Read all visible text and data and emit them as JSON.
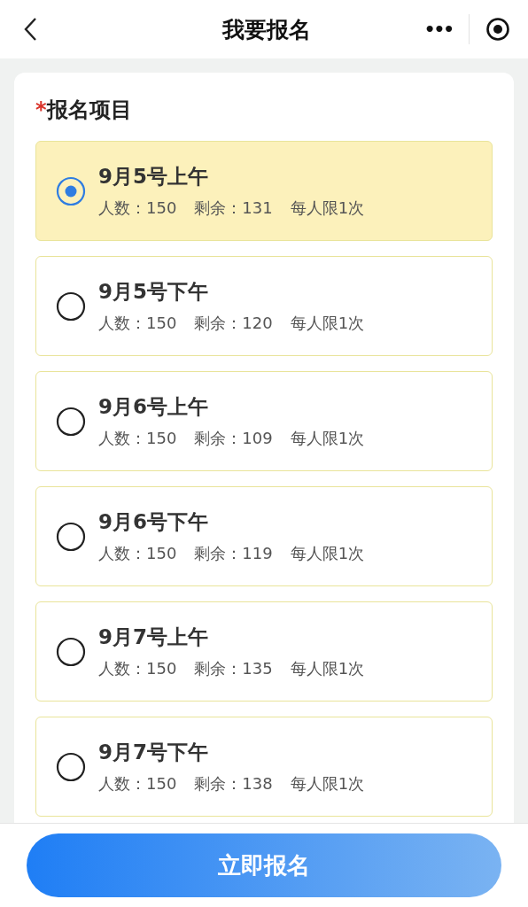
{
  "nav": {
    "title": "我要报名",
    "more": "•••"
  },
  "section": {
    "required_mark": "*",
    "label": "报名项目"
  },
  "options": [
    {
      "title": "9月5号上午",
      "count": "人数：150",
      "remaining": "剩余：131",
      "limit": "每人限1次",
      "selected": true
    },
    {
      "title": "9月5号下午",
      "count": "人数：150",
      "remaining": "剩余：120",
      "limit": "每人限1次",
      "selected": false
    },
    {
      "title": "9月6号上午",
      "count": "人数：150",
      "remaining": "剩余：109",
      "limit": "每人限1次",
      "selected": false
    },
    {
      "title": "9月6号下午",
      "count": "人数：150",
      "remaining": "剩余：119",
      "limit": "每人限1次",
      "selected": false
    },
    {
      "title": "9月7号上午",
      "count": "人数：150",
      "remaining": "剩余：135",
      "limit": "每人限1次",
      "selected": false
    },
    {
      "title": "9月7号下午",
      "count": "人数：150",
      "remaining": "剩余：138",
      "limit": "每人限1次",
      "selected": false
    }
  ],
  "submit": "立即报名"
}
